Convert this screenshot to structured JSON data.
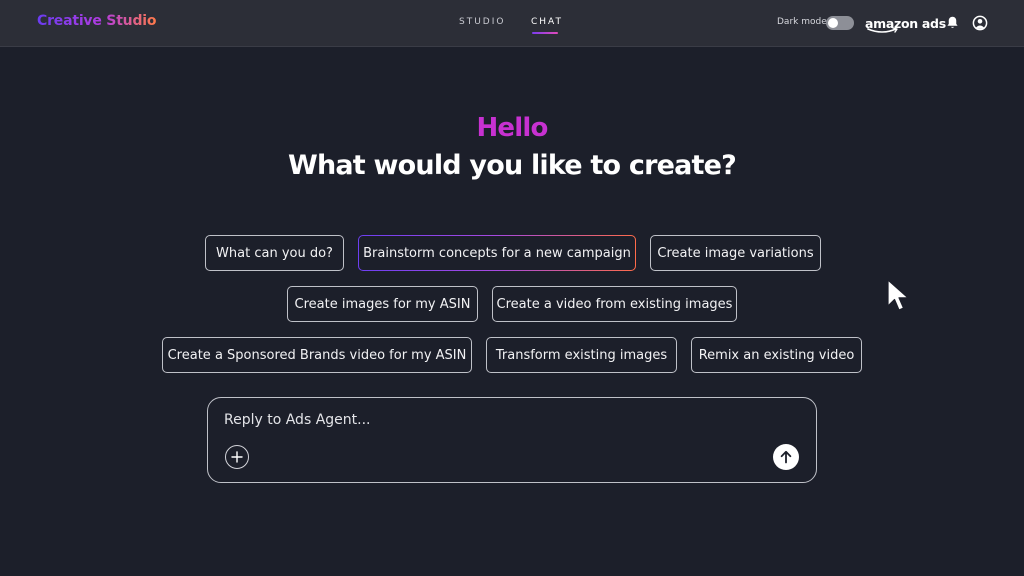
{
  "header": {
    "brand": "Creative Studio",
    "tabs": [
      {
        "label": "STUDIO",
        "active": false
      },
      {
        "label": "CHAT",
        "active": true
      }
    ],
    "dark_mode_label": "Dark mode",
    "dark_mode_on": false,
    "partner_logo": "amazon ads",
    "icons": [
      "bell-icon",
      "user-account-icon"
    ]
  },
  "greeting": {
    "hello": "Hello",
    "headline": "What would you like to create?"
  },
  "suggestions": [
    "What can you do?",
    "Brainstorm concepts for a new campaign",
    "Create image variations",
    "Create images for my ASIN",
    "Create a video from existing images",
    "Create a Sponsored Brands video for my ASIN",
    "Transform existing images",
    "Remix an existing video"
  ],
  "composer": {
    "placeholder": "Reply to Ads Agent...",
    "value": "",
    "add_icon": "plus-icon",
    "send_icon": "arrow-up-icon"
  },
  "colors": {
    "background": "#1c1f2a",
    "topbar": "#2c2e37",
    "hello_accent": "#c731d1",
    "brand_gradient": [
      "#6a3cf0",
      "#b23ce0",
      "#ff7a4a"
    ]
  }
}
